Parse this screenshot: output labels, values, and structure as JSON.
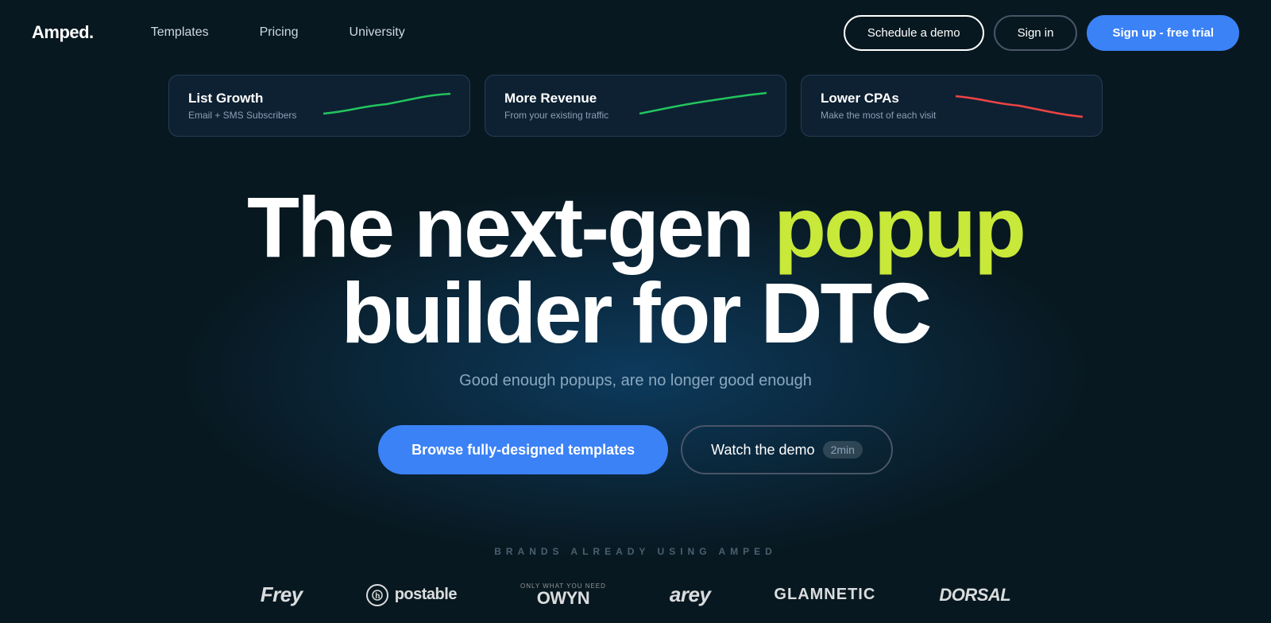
{
  "nav": {
    "logo": "Amped.",
    "links": [
      {
        "label": "Templates",
        "id": "templates"
      },
      {
        "label": "Pricing",
        "id": "pricing"
      },
      {
        "label": "University",
        "id": "university"
      }
    ],
    "schedule_label": "Schedule a demo",
    "signin_label": "Sign in",
    "signup_label": "Sign up - free trial"
  },
  "stat_cards": [
    {
      "title": "List Growth",
      "subtitle": "Email + SMS Subscribers",
      "chart_color": "#22c55e",
      "chart_type": "growth"
    },
    {
      "title": "More Revenue",
      "subtitle": "From your existing traffic",
      "chart_color": "#22c55e",
      "chart_type": "growth"
    },
    {
      "title": "Lower CPAs",
      "subtitle": "Make the most of each visit",
      "chart_color": "#ef4444",
      "chart_type": "decline"
    }
  ],
  "hero": {
    "line1_white": "The next-gen",
    "line1_yellow": "popup",
    "line2": "builder for DTC",
    "subtext": "Good enough popups, are no longer good enough"
  },
  "cta": {
    "browse_label": "Browse fully-designed templates",
    "watch_label": "Watch the demo",
    "watch_duration": "2min"
  },
  "brands": {
    "label": "BRANDS ALREADY USING AMPED",
    "items": [
      {
        "name": "Frey",
        "class": "frey"
      },
      {
        "name": "postable",
        "class": "postable"
      },
      {
        "name": "OWYN",
        "class": "owyn"
      },
      {
        "name": "arey",
        "class": "arey"
      },
      {
        "name": "GLAMNETIC",
        "class": "glamnetic"
      },
      {
        "name": "DORSAL",
        "class": "dorsal"
      }
    ]
  }
}
